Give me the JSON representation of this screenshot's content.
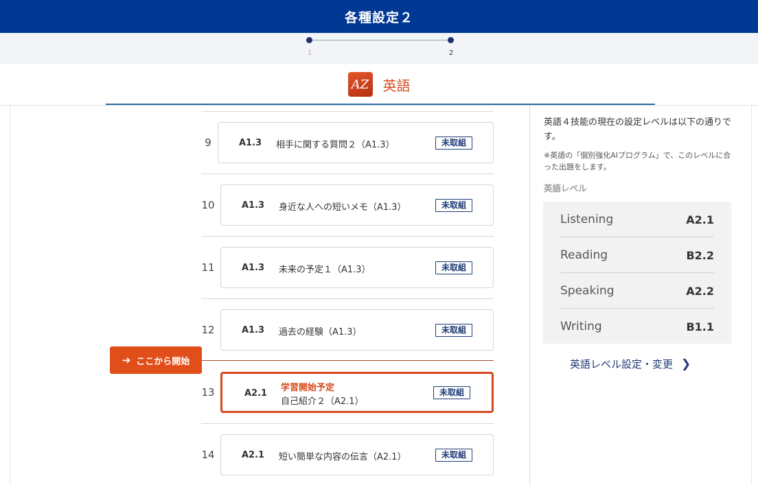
{
  "header": {
    "title": "各種設定２"
  },
  "steps": [
    {
      "label": "1"
    },
    {
      "label": "2"
    }
  ],
  "colors": {
    "header": "#003893",
    "accent": "#d6491b",
    "step_active": "#1b3468",
    "badge": "#1e3a75"
  },
  "subject": {
    "logo_text": "AZ",
    "logo_icon": "a-to-z-logo-icon",
    "name": "英語"
  },
  "units": [
    {
      "num": "9",
      "level": "A1.3",
      "title": "相手に関する質問２（A1.3）",
      "status": "未取組"
    },
    {
      "num": "10",
      "level": "A1.3",
      "title": "身近な人への短いメモ（A1.3）",
      "status": "未取組"
    },
    {
      "num": "11",
      "level": "A1.3",
      "title": "未来の予定１（A1.3）",
      "status": "未取組"
    },
    {
      "num": "12",
      "level": "A1.3",
      "title": "過去の経験（A1.3）",
      "status": "未取組"
    },
    {
      "num": "13",
      "level": "A2.1",
      "plan": "学習開始予定",
      "title": "自己紹介２（A2.1）",
      "status": "未取組"
    },
    {
      "num": "14",
      "level": "A2.1",
      "title": "短い簡単な内容の伝言（A2.1）",
      "status": "未取組"
    }
  ],
  "start_button": {
    "label": "ここから開始",
    "icon": "arrow-right-icon"
  },
  "side": {
    "description": "英語４技能の現在の設定レベルは以下の通りです。",
    "note": "※英語の「個別強化AIプログラム」で、このレベルに合った出題をします。",
    "level_label": "英語レベル",
    "skills": [
      {
        "name": "Listening",
        "value": "A2.1"
      },
      {
        "name": "Reading",
        "value": "B2.2"
      },
      {
        "name": "Speaking",
        "value": "A2.2"
      },
      {
        "name": "Writing",
        "value": "B1.1"
      }
    ],
    "link": {
      "label": "英語レベル設定・変更",
      "icon": "chevron-right-icon"
    }
  }
}
